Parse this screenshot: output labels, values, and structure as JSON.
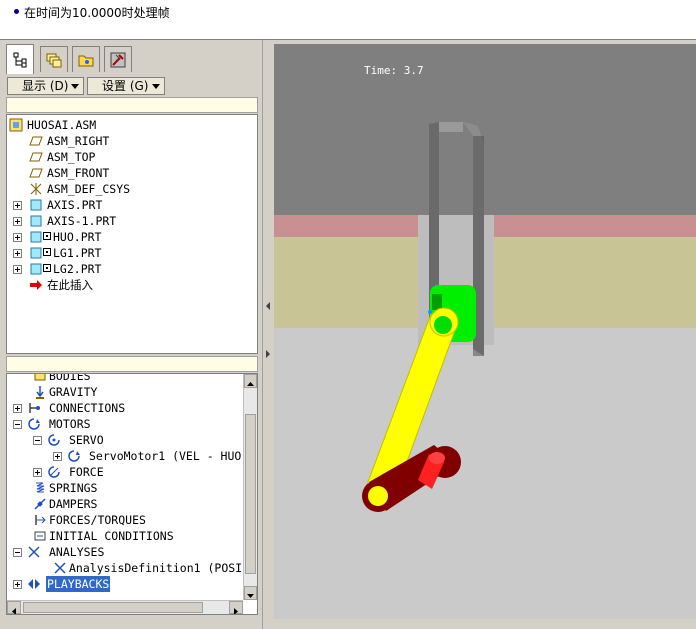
{
  "status": {
    "message": "在时间为10.0000时处理帧"
  },
  "toolbar": {
    "show_label": "显示 (D)",
    "settings_label": "设置 (G)"
  },
  "model_tree": {
    "root": "HUOSAI.ASM",
    "items": [
      "ASM_RIGHT",
      "ASM_TOP",
      "ASM_FRONT",
      "ASM_DEF_CSYS",
      "AXIS.PRT",
      "AXIS-1.PRT",
      "HUO.PRT",
      "LG1.PRT",
      "LG2.PRT",
      "在此插入"
    ]
  },
  "mech_tree": {
    "items": [
      "BODIES",
      "GRAVITY",
      "CONNECTIONS",
      "MOTORS",
      "SERVO",
      "ServoMotor1 (VEL - HUO",
      "FORCE",
      "SPRINGS",
      "DAMPERS",
      "FORCES/TORQUES",
      "INITIAL CONDITIONS",
      "ANALYSES",
      "AnalysisDefinition1 (POSI",
      "PLAYBACKS"
    ]
  },
  "viewport": {
    "time_label": "Time: 3.7"
  },
  "colors": {
    "background": "#7f7f7f",
    "selection": "#316ac5",
    "link": "#ffff00",
    "piston": "#00ff00",
    "crank": "#800000",
    "crank_pin": "#ff0000"
  }
}
